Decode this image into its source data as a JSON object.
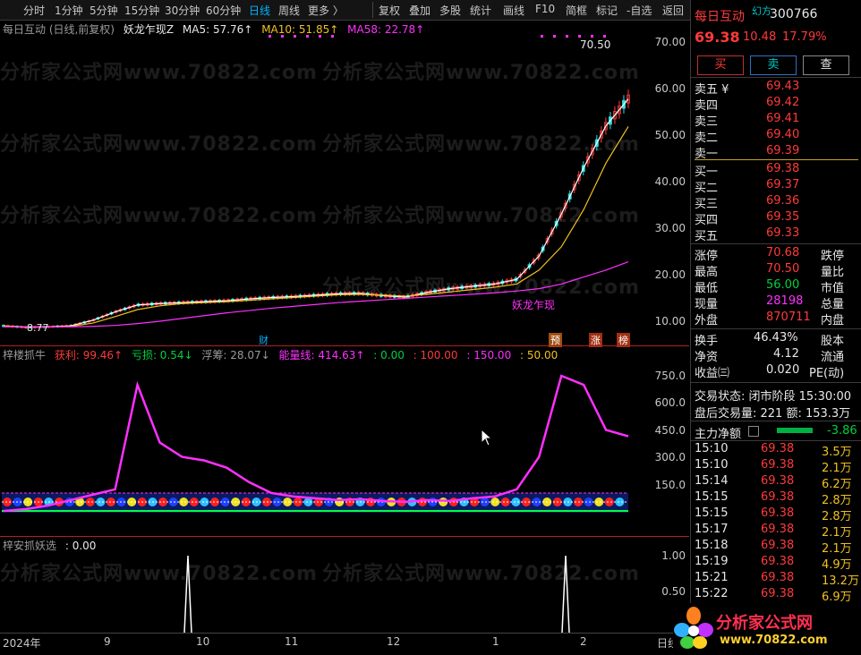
{
  "toolbar": {
    "left": [
      "分时",
      "1分钟",
      "5分钟",
      "15分钟",
      "30分钟",
      "60分钟",
      "日线",
      "周线",
      "更多 〉"
    ],
    "active": "日线",
    "right": [
      "复权",
      "叠加",
      "多股",
      "统计",
      "画线",
      "F10",
      "简框",
      "标记",
      "-自选",
      "返回"
    ]
  },
  "main_chart": {
    "stock_label": "每日互动 (日线,前复权)",
    "indicator_name": "妖龙乍现Z",
    "ma5": "MA5: 57.76↑",
    "ma10": "MA10: 51.85↑",
    "ma58": "MA58: 22.78↑",
    "high_label": "70.50",
    "low_label": "8.77",
    "signal_label": "妖龙乍现",
    "y_ticks": [
      "70.00",
      "60.00",
      "50.00",
      "40.00",
      "30.00",
      "20.00",
      "10.00"
    ],
    "markers": [
      "财",
      "预",
      "涨",
      "榜"
    ],
    "watermark": "分析家公式网www.70822.com"
  },
  "sub_chart1": {
    "name": "梓楼抓牛",
    "profit": "获利: 99.46↑",
    "loss": "亏损: 0.54↓",
    "float": "浮筹: 28.07↓",
    "energy": "能量线: 414.63↑",
    "v0": ": 0.00",
    "v100": ": 100.00",
    "v150": ": 150.00",
    "v50": ": 50.00",
    "y_ticks": [
      "750.0",
      "600.0",
      "450.0",
      "300.0",
      "150.0"
    ]
  },
  "sub_chart2": {
    "name": "梓安抓妖选",
    "value": ": 0.00",
    "y_ticks": [
      "1.00",
      "0.50"
    ]
  },
  "x_axis": {
    "labels": [
      "2024年",
      "9",
      "10",
      "11",
      "12",
      "1",
      "2"
    ],
    "right_label": "日线"
  },
  "chart_data": {
    "type": "line",
    "title": "",
    "ylim": [
      0,
      75
    ],
    "series": [
      {
        "name": "MA5",
        "values": [
          9,
          8.7,
          8.8,
          9,
          10.2,
          12,
          13.5,
          13.8,
          14,
          14.2,
          14.4,
          14.8,
          15.1,
          15.3,
          15.6,
          15.9,
          16,
          15.5,
          15.2,
          16.2,
          17,
          17.5,
          18,
          19,
          24,
          33,
          43,
          52,
          57.76
        ]
      },
      {
        "name": "MA10",
        "values": [
          9,
          8.8,
          8.8,
          8.9,
          9.6,
          11,
          12.5,
          13.3,
          13.8,
          14,
          14.2,
          14.5,
          14.8,
          15.1,
          15.4,
          15.7,
          15.8,
          15.6,
          15.4,
          15.8,
          16.3,
          16.8,
          17.3,
          18,
          21,
          26,
          34,
          44,
          51.85
        ]
      },
      {
        "name": "MA58",
        "values": [
          8.8,
          8.8,
          8.8,
          8.8,
          8.9,
          9.1,
          9.5,
          10,
          10.6,
          11.2,
          11.8,
          12.3,
          12.8,
          13.2,
          13.6,
          14,
          14.3,
          14.6,
          14.9,
          15.2,
          15.5,
          15.8,
          16.1,
          16.5,
          17,
          18,
          19.5,
          21,
          22.78
        ]
      }
    ],
    "energy_line": [
      0,
      10,
      30,
      60,
      90,
      120,
      700,
      380,
      300,
      280,
      240,
      160,
      100,
      80,
      70,
      60,
      65,
      55,
      50,
      60,
      55,
      70,
      80,
      120,
      300,
      750,
      700,
      450,
      414.63
    ]
  },
  "panel": {
    "name": "每日互动",
    "badge": "幻方",
    "code": "300766",
    "price": "69.38",
    "change": "10.48",
    "pct": "17.79%",
    "buy_btn": "买",
    "sell_btn": "卖",
    "view_btn": "查",
    "asks": [
      {
        "label": "卖五 ¥",
        "price": "69.43"
      },
      {
        "label": "卖四",
        "price": "69.42"
      },
      {
        "label": "卖三",
        "price": "69.41"
      },
      {
        "label": "卖二",
        "price": "69.40"
      },
      {
        "label": "卖一",
        "price": "69.39"
      }
    ],
    "bids": [
      {
        "label": "买一",
        "price": "69.38"
      },
      {
        "label": "买二",
        "price": "69.37"
      },
      {
        "label": "买三",
        "price": "69.36"
      },
      {
        "label": "买四",
        "price": "69.35"
      },
      {
        "label": "买五",
        "price": "69.33"
      }
    ],
    "stats": [
      {
        "l": "涨停",
        "v": "70.68",
        "r": "跌停"
      },
      {
        "l": "最高",
        "v": "70.50",
        "r": "量比"
      },
      {
        "l": "最低",
        "v": "56.00",
        "r": "市值"
      },
      {
        "l": "现量",
        "v": "28198",
        "r": "总量"
      },
      {
        "l": "外盘",
        "v": "870711",
        "r": "内盘"
      }
    ],
    "stats2": [
      {
        "l": "换手",
        "v": "46.43%",
        "r": "股本"
      },
      {
        "l": "净资",
        "v": "4.12",
        "r": "流通"
      },
      {
        "l": "收益㈢",
        "v": "0.020",
        "r": "PE(动)"
      }
    ],
    "trade_state": "交易状态: 闭市阶段 15:30:00",
    "after_hours": "盘后交易量: 221  额: 153.3万",
    "main_flow_label": "主力净额",
    "main_flow_value": "-3.86",
    "ticks": [
      {
        "t": "15:10",
        "p": "69.38",
        "v": "3.5万"
      },
      {
        "t": "15:10",
        "p": "69.38",
        "v": "2.1万"
      },
      {
        "t": "15:14",
        "p": "69.38",
        "v": "6.2万"
      },
      {
        "t": "15:15",
        "p": "69.38",
        "v": "2.8万"
      },
      {
        "t": "15:15",
        "p": "69.38",
        "v": "2.8万"
      },
      {
        "t": "15:17",
        "p": "69.38",
        "v": "2.1万"
      },
      {
        "t": "15:18",
        "p": "69.38",
        "v": "2.1万"
      },
      {
        "t": "15:19",
        "p": "69.38",
        "v": "4.9万"
      },
      {
        "t": "15:21",
        "p": "69.38",
        "v": "13.2万"
      },
      {
        "t": "15:22",
        "p": "69.38",
        "v": "6.9万"
      }
    ],
    "logo_text": "分析家公式网",
    "logo_url": "www.70822.com"
  }
}
